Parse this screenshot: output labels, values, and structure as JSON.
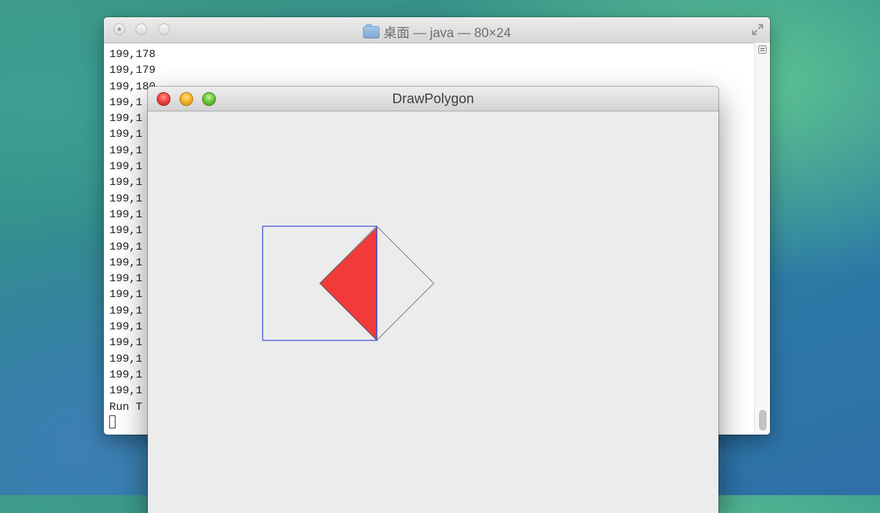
{
  "terminal": {
    "title": "桌面 — java — 80×24",
    "lines": [
      "199,178",
      "199,179",
      "199,180",
      "199,1",
      "199,1",
      "199,1",
      "199,1",
      "199,1",
      "199,1",
      "199,1",
      "199,1",
      "199,1",
      "199,1",
      "199,1",
      "199,1",
      "199,1",
      "199,1",
      "199,1",
      "199,1",
      "199,1",
      "199,1",
      "199,1",
      "Run T"
    ]
  },
  "app_window": {
    "title": "DrawPolygon"
  },
  "colors": {
    "square_stroke": "#3b4fd6",
    "triangle_fill": "#f33a3a",
    "diamond_stroke": "#777777"
  }
}
